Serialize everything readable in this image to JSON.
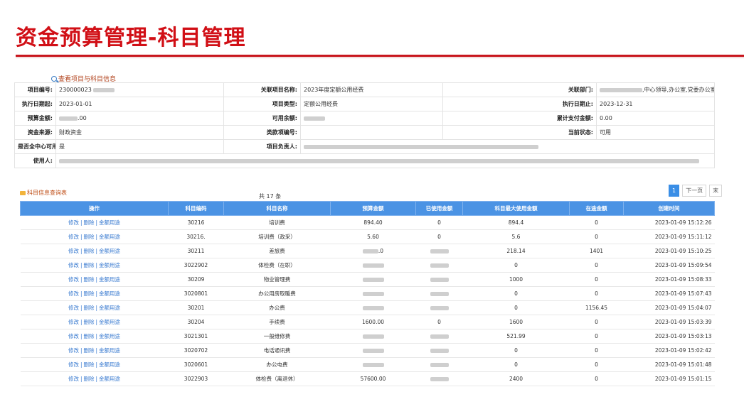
{
  "page": {
    "title": "资金预算管理-科目管理"
  },
  "links": {
    "view_project": "查看项目与科目信息",
    "subject_table": "科目信息查询表"
  },
  "info": {
    "project_no_label": "项目编号:",
    "project_no": "230000023",
    "linked_name_label": "关联项目名称:",
    "linked_name": "2023年度定额公用经费",
    "linked_dept_label": "关联部门:",
    "linked_dept": ",中心领导,办公室,党委办公室（纪检监察室）,财务审",
    "start_label": "执行日期起:",
    "start": "2023-01-01",
    "type_label": "项目类型:",
    "type": "定额公用经费",
    "end_label": "执行日期止:",
    "end": "2023-12-31",
    "budget_label": "预算金额:",
    "budget": ".00",
    "available_label": "可用余额:",
    "cum_pay_label": "累计支付金额:",
    "cum_pay": "0.00",
    "source_label": "资金来源:",
    "source": "财政资金",
    "class_no_label": "类款项编号:",
    "status_label": "当前状态:",
    "status": "可用",
    "center_label": "是否全中心可用:",
    "center": "是",
    "owner_label": "项目负责人:",
    "user_label": "使用人:"
  },
  "pager": {
    "total_prefix": "共",
    "total_count": "17",
    "total_suffix": "条",
    "page1": "1",
    "next": "下一页",
    "last": "末"
  },
  "ops": {
    "edit": "修改",
    "delete": "删除",
    "usage": "金额用途"
  },
  "grid": {
    "headers": [
      "操作",
      "科目编码",
      "科目名称",
      "预算金额",
      "已使用金额",
      "科目最大使用金额",
      "在途金额",
      "创建时间"
    ],
    "rows": [
      {
        "code": "30216",
        "name": "培训费",
        "budget": "894.40",
        "used": "0",
        "max": "894.4",
        "transit": "0",
        "time": "2023-01-09 15:12:26"
      },
      {
        "code": "30216.",
        "name": "培训费（政采）",
        "budget": "5.60",
        "used": "0",
        "max": "5.6",
        "transit": "0",
        "time": "2023-01-09 15:11:12"
      },
      {
        "code": "30211",
        "name": "差旅费",
        "budget": ".0",
        "used": "",
        "max": "218.14",
        "transit": "1401",
        "time": "2023-01-09 15:10:25"
      },
      {
        "code": "3022902",
        "name": "体检费（在职）",
        "budget": "",
        "used": "",
        "max": "0",
        "transit": "0",
        "time": "2023-01-09 15:09:54"
      },
      {
        "code": "30209",
        "name": "物业管理费",
        "budget": "",
        "used": "",
        "max": "1000",
        "transit": "0",
        "time": "2023-01-09 15:08:33"
      },
      {
        "code": "3020801",
        "name": "办公用房取暖费",
        "budget": "",
        "used": "",
        "max": "0",
        "transit": "0",
        "time": "2023-01-09 15:07:43"
      },
      {
        "code": "30201",
        "name": "办公费",
        "budget": "",
        "used": "",
        "max": "0",
        "transit": "1156.45",
        "time": "2023-01-09 15:04:07"
      },
      {
        "code": "30204",
        "name": "手续费",
        "budget": "1600.00",
        "used": "0",
        "max": "1600",
        "transit": "0",
        "time": "2023-01-09 15:03:39"
      },
      {
        "code": "3021301",
        "name": "一般维修费",
        "budget": "",
        "used": "",
        "max": "521.99",
        "transit": "0",
        "time": "2023-01-09 15:03:13"
      },
      {
        "code": "3020702",
        "name": "电话通讯费",
        "budget": "",
        "used": "",
        "max": "0",
        "transit": "0",
        "time": "2023-01-09 15:02:42"
      },
      {
        "code": "3020601",
        "name": "办公电费",
        "budget": "",
        "used": "",
        "max": "0",
        "transit": "0",
        "time": "2023-01-09 15:01:48"
      },
      {
        "code": "3022903",
        "name": "体检费（离退休）",
        "budget": "57600.00",
        "used": "",
        "max": "2400",
        "transit": "0",
        "time": "2023-01-09 15:01:15"
      }
    ]
  }
}
